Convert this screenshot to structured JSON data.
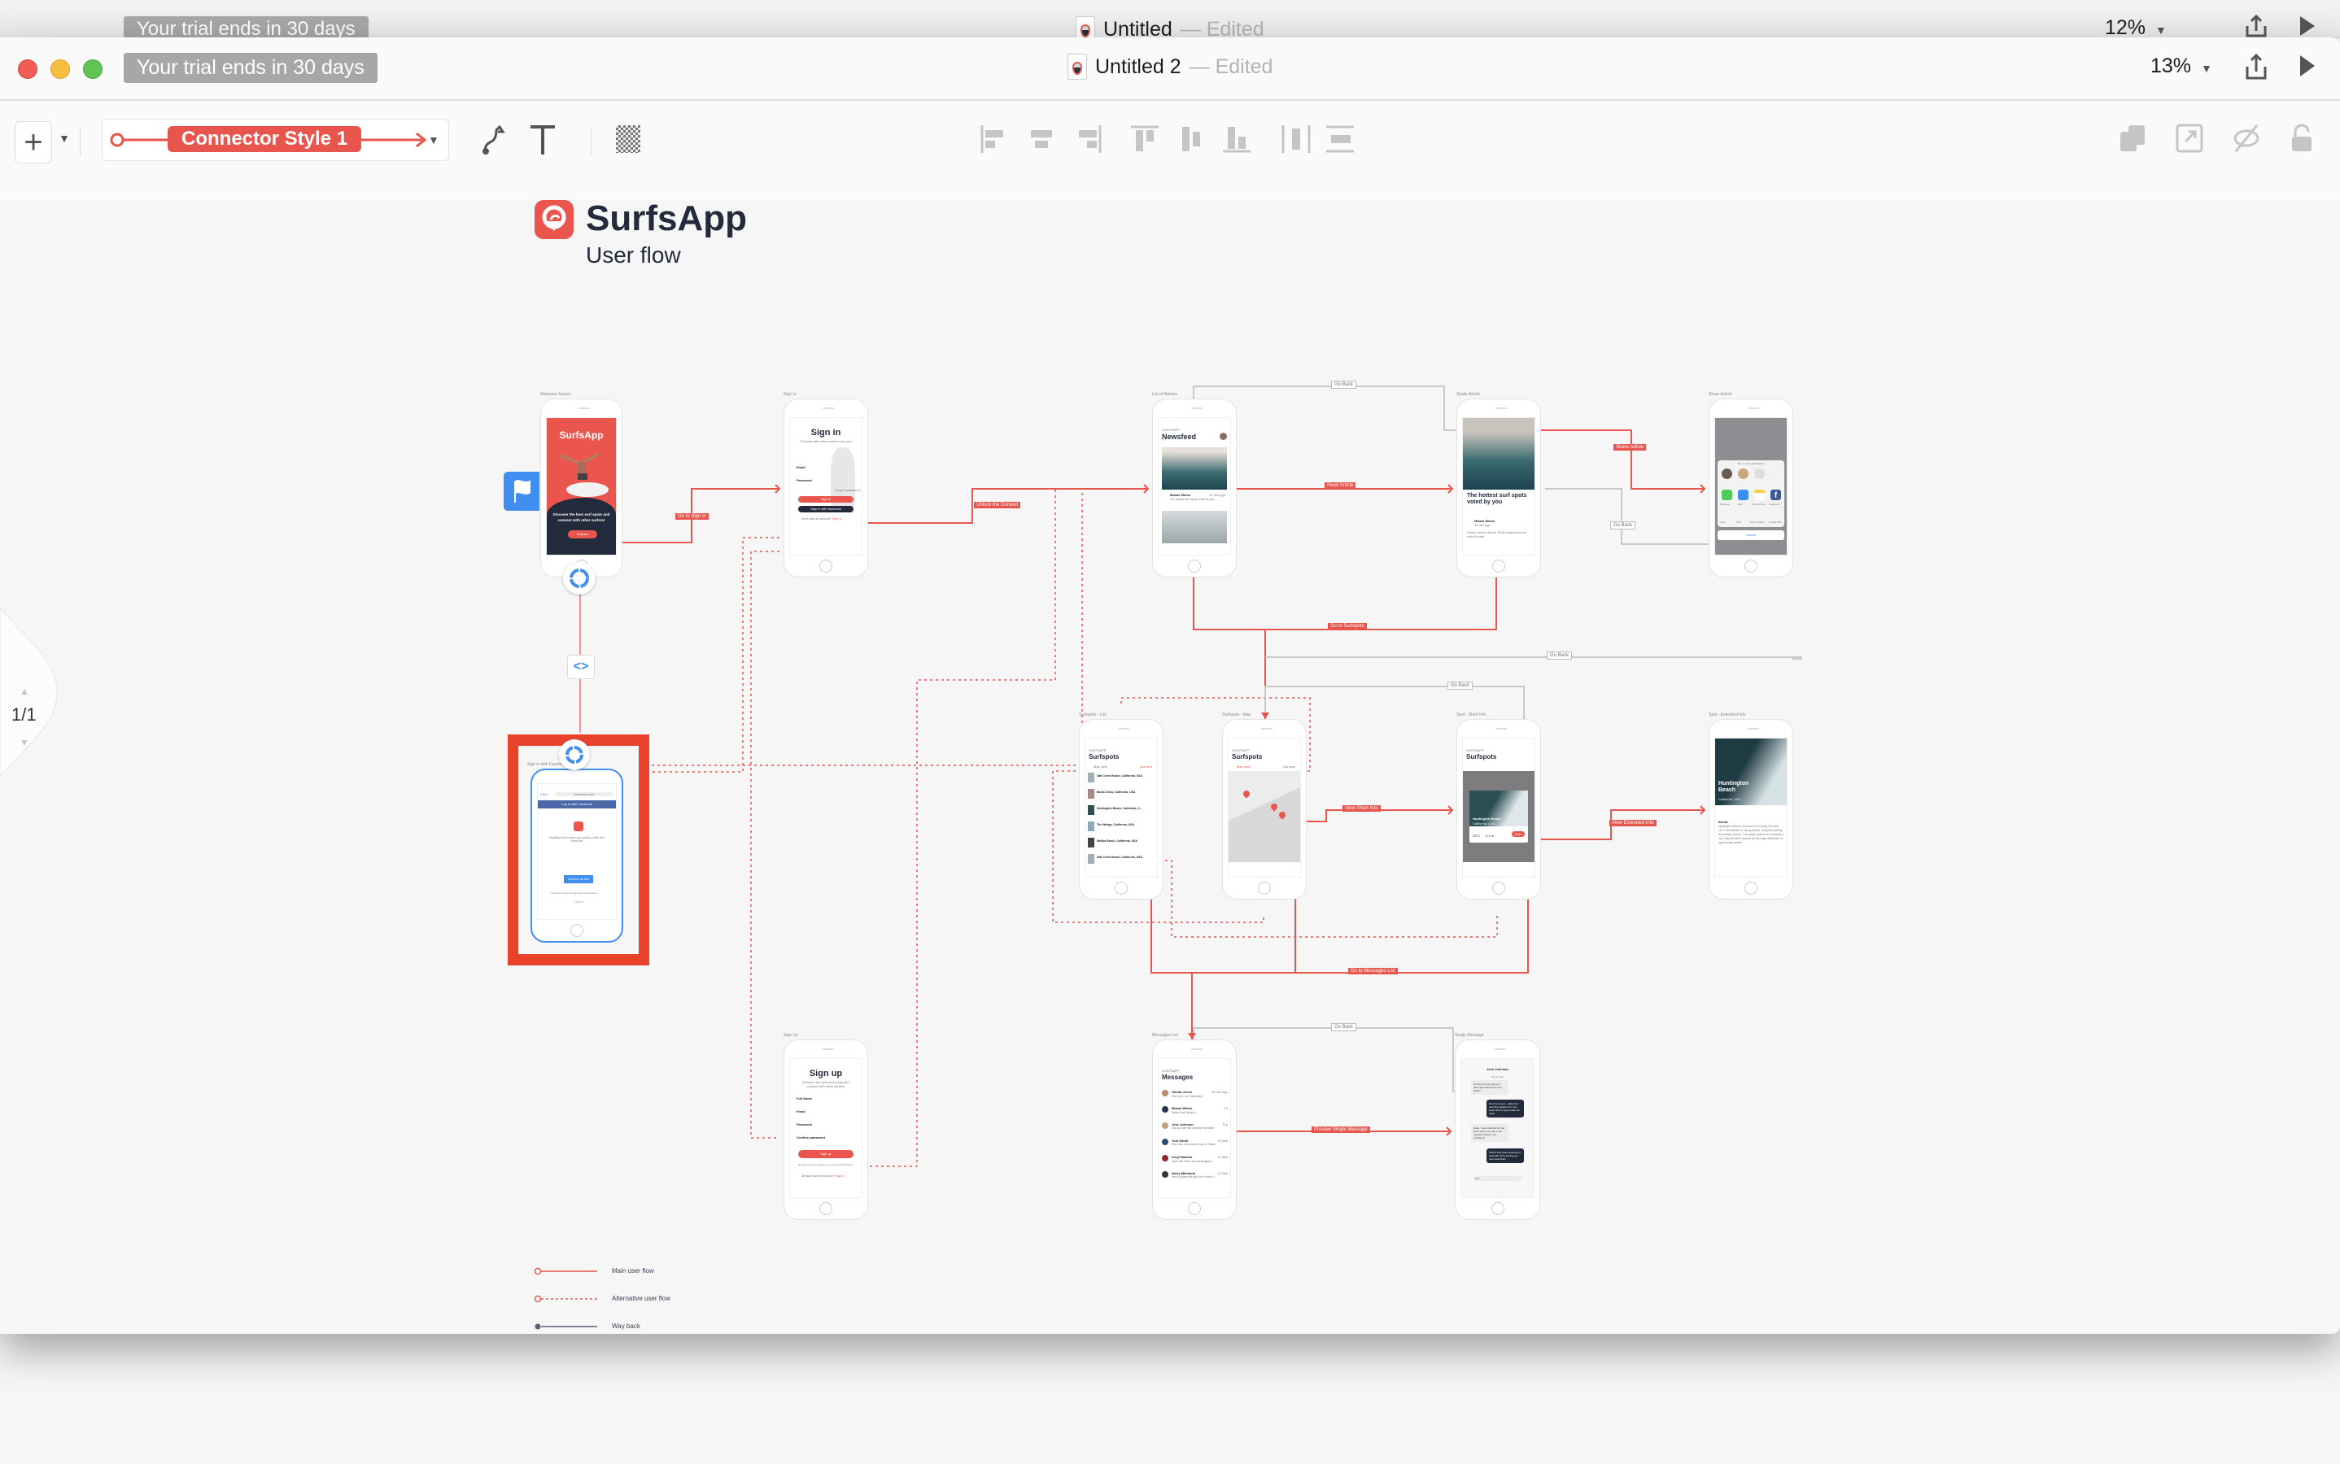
{
  "back_window": {
    "trial_badge": "Your trial ends in 30 days",
    "title": "Untitled",
    "edited": "— Edited",
    "zoom": "12%"
  },
  "window": {
    "trial_badge": "Your trial ends in 30 days",
    "title": "Untitled 2",
    "edited": "— Edited",
    "zoom": "13%",
    "traffic_lights": {
      "close": "#ee5e57",
      "minimize": "#f6bd41",
      "zoom": "#5fc454"
    }
  },
  "toolbar": {
    "connector_style": "Connector Style 1",
    "accent": "#e8554c"
  },
  "canvas": {
    "brand": "SurfsApp",
    "subtitle": "User flow",
    "page_indicator": "1/1",
    "screens": {
      "welcome": {
        "label": "Welcome Screen",
        "title": "SurfsApp",
        "text": "Discover the best surf spots and connect with other surfers!",
        "button": "Explore"
      },
      "sign_in": {
        "label": "Sign In",
        "title": "Sign in",
        "subtitle": "Connect with other surfers near you",
        "email": "Email",
        "password": "Password",
        "forgot": "Forgot password?",
        "button": "Sign in",
        "facebook": "Sign in with facebook",
        "footer": "Don't have an account?",
        "footer_link": "Sign up"
      },
      "newsfeed": {
        "label": "List of Articles",
        "overline": "SURFSAPP",
        "title": "Newsfeed",
        "author": "Mikael Weber",
        "time": "12 min ago",
        "excerpt": "The hottest surf spots voted by you"
      },
      "single_article": {
        "label": "Single Article",
        "title": "The hottest surf spots voted by you",
        "author": "Mikael Weber",
        "time": "45 min ago",
        "text": "Check out the list for 2018 created by the world's best"
      },
      "share_article": {
        "label": "Share Article",
        "airdrop": "Tap to share with AirDrop",
        "apps": [
          "Message",
          "Mail",
          "Add to Notes",
          "Facebook"
        ],
        "actions": [
          "Copy",
          "Print",
          "Save to Files",
          "Create PDF"
        ],
        "cancel": "Cancel"
      },
      "surfspots_list": {
        "label": "Surfspots - List",
        "overline": "SURFSAPP",
        "title": "Surfspots",
        "map_view": "Map view",
        "list_view": "List view",
        "spots": [
          "Salt Creek Beach, California, USA",
          "Bolsa Chica, California, USA",
          "Huntington Beach, California, U...",
          "The Wedge, California, USA",
          "Malibu Beach, California, USA",
          "Salt Creek Beach, California, USA"
        ]
      },
      "surfspots_map": {
        "label": "Surfspots - Map",
        "overline": "SURFSAPP",
        "title": "Surfspots",
        "map_view": "Map view",
        "list_view": "List view"
      },
      "spot_short": {
        "label": "Spot - Short Info",
        "overline": "SURFSAPP",
        "title": "Surfspots",
        "spot": "Huntington Beach",
        "location": "California, USA",
        "water": "23°C",
        "swell": "2.1 m",
        "button": "More"
      },
      "spot_extended": {
        "label": "Spot - Extended Info",
        "title": "Huntington Beach",
        "location": "California, USA",
        "about": "About",
        "text": "Huntington Beach is known for its long, 8.5-mile (13.7 km) stretch of sandy beach, excellent surfing, and beach culture. The ocean waves are enhanced by a natural effect caused by the edge diffraction of open ocean swells."
      },
      "sign_up": {
        "label": "Sign Up",
        "title": "Sign up",
        "subtitle": "Discover the best surf spots and connect with other surfers!",
        "fields": [
          "Full Name",
          "Email",
          "Password",
          "Confirm password"
        ],
        "button": "Sign up",
        "terms": "By signing up you agree to our Terms & Conditions",
        "footer": "Already have an account?",
        "footer_link": "Sign in"
      },
      "messages": {
        "label": "Messages List",
        "overline": "SURFSAPP",
        "title": "Messages",
        "threads": [
          {
            "name": "Olinda Jones",
            "time": "45 min ago",
            "preview": "See you on Saturday!"
          },
          {
            "name": "Mikael Weber",
            "time": "Fri",
            "preview": "Vans Surf World..."
          },
          {
            "name": "Jess Johnson",
            "time": "Thu",
            "preview": "Did you see the weather forecast?"
          },
          {
            "name": "Tom Smith",
            "time": "20 Mar",
            "preview": "Hey man Jess want to go on Satur..."
          },
          {
            "name": "Kenji Raviloo",
            "time": "11 Mar",
            "preview": "Nice tail slide at Huntington!"
          },
          {
            "name": "Nicky Mikimoto",
            "time": "02 Mar",
            "preview": "We're going with girls for a tube s..."
          }
        ]
      },
      "single_message": {
        "label": "Single Message",
        "contact": "Jess Johnson",
        "time": "45 min ago",
        "bubbles": [
          {
            "from": "them",
            "text": "Hi Tom! Are you going to Vans Surf World Cup next week?"
          },
          {
            "from": "me",
            "text": "Don't know yet... gotta do a user flow diagram for next week and it's gonna take me ages!"
          },
          {
            "from": "them",
            "text": "Dude, I use Overflow for that and it takes me only a few minutes! Check it out. overflow.io"
          },
          {
            "from": "me",
            "text": "WOW! This looks amazing! It looks like I'll be seeing you next week then!"
          }
        ],
        "input": "Aa"
      },
      "facebook": {
        "label": "Sign in with Facebook",
        "done": "Done",
        "url": "facebook.com",
        "header": "Log in with Facebook",
        "text": "SurfsApp will receive your public profile and friend list",
        "edit": "Edit This",
        "button": "Continue as Tom",
        "note": "This does not let the app post to Facebook",
        "cancel": "Cancel"
      }
    },
    "edges": {
      "go_to_sign_in": "Go to Sign in",
      "unlock": "Unlock the Content",
      "read_article": "Read Article",
      "share_article": "Share Article",
      "go_back": "Go Back",
      "go_to_surfspots": "Go to Surfspots",
      "view_short": "View Short Info",
      "view_extended": "View Extended Info",
      "go_to_messages": "Go to Messages List",
      "preview_message": "Preview Single Message"
    },
    "legend": [
      {
        "label": "Main user flow"
      },
      {
        "label": "Alternative user flow"
      },
      {
        "label": "Way back"
      }
    ]
  }
}
